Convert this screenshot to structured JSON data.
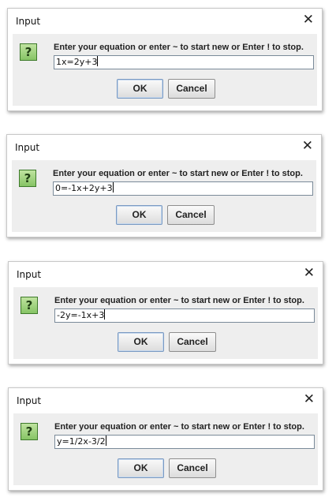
{
  "dialogs": [
    {
      "title": "Input",
      "close_glyph": "✕",
      "icon": "question-icon",
      "icon_glyph": "?",
      "prompt": "Enter your equation or enter ~ to start new or Enter ! to stop.",
      "input_value": "1x=2y+3",
      "ok_label": "OK",
      "cancel_label": "Cancel"
    },
    {
      "title": "Input",
      "close_glyph": "✕",
      "icon": "question-icon",
      "icon_glyph": "?",
      "prompt": "Enter your equation or enter ~ to start new or Enter ! to stop.",
      "input_value": "0=-1x+2y+3",
      "ok_label": "OK",
      "cancel_label": "Cancel"
    },
    {
      "title": "Input",
      "close_glyph": "✕",
      "icon": "question-icon",
      "icon_glyph": "?",
      "prompt": "Enter your equation or enter ~ to start new or Enter ! to stop.",
      "input_value": "-2y=-1x+3",
      "ok_label": "OK",
      "cancel_label": "Cancel"
    },
    {
      "title": "Input",
      "close_glyph": "✕",
      "icon": "question-icon",
      "icon_glyph": "?",
      "prompt": "Enter your equation or enter ~ to start new or Enter ! to stop.",
      "input_value": "y=1/2x-3/2",
      "ok_label": "OK",
      "cancel_label": "Cancel"
    }
  ],
  "colors": {
    "dialog_background": "#ffffff",
    "content_background": "#eeeeee",
    "icon_green": "#86c465",
    "ok_border": "#7a9ac2"
  }
}
